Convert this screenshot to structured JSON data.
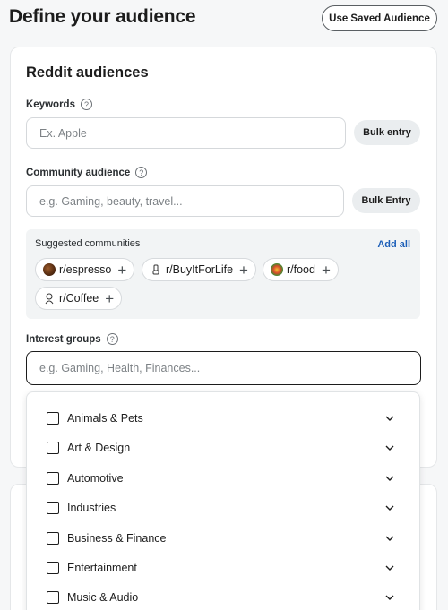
{
  "header": {
    "title": "Define your audience",
    "saved_button": "Use Saved Audience"
  },
  "section": {
    "title": "Reddit audiences"
  },
  "keywords": {
    "label": "Keywords",
    "help": "?",
    "placeholder": "Ex. Apple",
    "bulk_label": "Bulk entry"
  },
  "community": {
    "label": "Community audience",
    "help": "?",
    "placeholder": "e.g. Gaming, beauty, travel...",
    "bulk_label": "Bulk Entry"
  },
  "suggested": {
    "title": "Suggested communities",
    "add_all": "Add all",
    "plus": "+",
    "items": [
      {
        "label": "r/espresso",
        "avatar_color": "#5a2f12"
      },
      {
        "label": "r/BuyItForLife",
        "avatar_color": "#ffffff"
      },
      {
        "label": "r/food",
        "avatar_color": "#3d8b2f"
      },
      {
        "label": "r/Coffee",
        "avatar_color": "#ffffff"
      }
    ]
  },
  "interest": {
    "label": "Interest groups",
    "help": "?",
    "placeholder": "e.g. Gaming, Health, Finances...",
    "options": [
      "Animals & Pets",
      "Art & Design",
      "Automotive",
      "Industries",
      "Business & Finance",
      "Entertainment",
      "Music & Audio"
    ]
  },
  "icons": {
    "help": "question-circle-icon",
    "plus": "plus-icon",
    "chevron": "chevron-down-icon",
    "checkbox": "checkbox-unchecked-icon"
  },
  "colors": {
    "link": "#1d5fb8",
    "pill": "#eaedef",
    "suggest_bg": "#f2f4f5"
  }
}
